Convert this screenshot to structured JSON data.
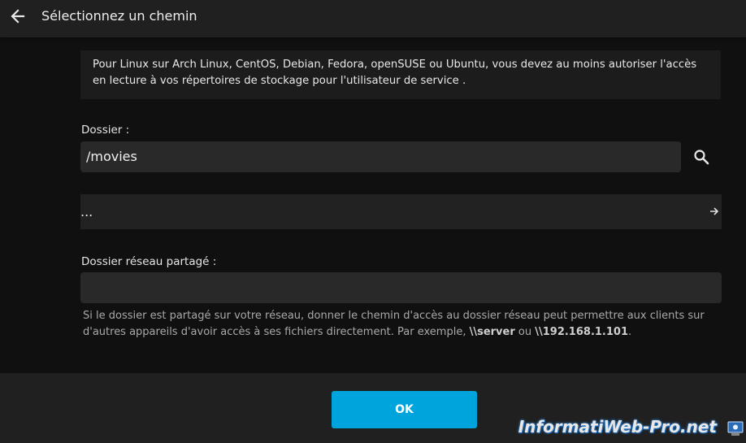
{
  "header": {
    "title": "Sélectionnez un chemin",
    "back_icon": "arrow-left-icon"
  },
  "info": {
    "text": "Pour Linux sur Arch Linux, CentOS, Debian, Fedora, openSUSE ou Ubuntu, vous devez au moins autoriser l'accès en lecture à vos répertoires de stockage pour l'utilisateur de service ."
  },
  "folder": {
    "label": "Dossier :",
    "value": "/movies",
    "search_icon": "search-icon"
  },
  "parent_row": {
    "label": "...",
    "icon": "arrow-right-icon"
  },
  "network": {
    "label": "Dossier réseau partagé :",
    "value": "",
    "help_text": "Si le dossier est partagé sur votre réseau, donner le chemin d'accès au dossier réseau peut permettre aux clients sur d'autres appareils d'avoir accès à ses fichiers directement. Par exemple, ",
    "example_1": "\\\\server",
    "separator": " ou ",
    "example_2": "\\\\192.168.1.101",
    "end": "."
  },
  "footer": {
    "ok_label": "OK"
  },
  "watermark": {
    "text": "InformatiWeb-Pro.net"
  },
  "colors": {
    "accent": "#00a4dc",
    "background": "#101010",
    "panel": "#202020",
    "input": "#292929"
  }
}
